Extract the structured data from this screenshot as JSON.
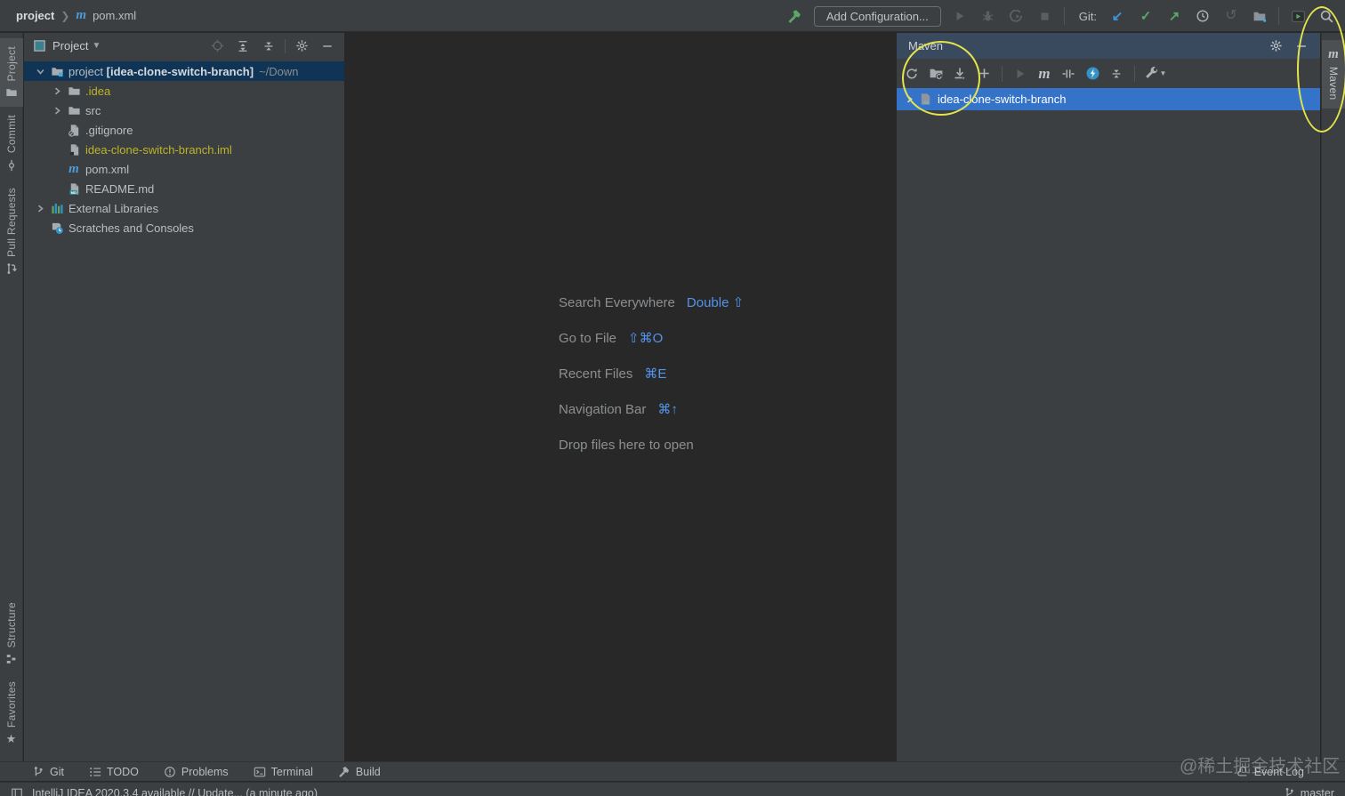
{
  "topbar": {
    "breadcrumb_project": "project",
    "breadcrumb_file": "pom.xml",
    "add_configuration": "Add Configuration...",
    "git_label": "Git:",
    "update_glyph": "↙",
    "commit_glyph": "✓",
    "push_glyph": "↗",
    "rollback_glyph": "↺"
  },
  "left_strip": {
    "project": "Project",
    "commit": "Commit",
    "pull_requests": "Pull Requests",
    "structure": "Structure",
    "favorites": "Favorites"
  },
  "project_panel": {
    "title": "Project",
    "tree": [
      {
        "name": "project",
        "bold": "[idea-clone-switch-branch]",
        "suffix": "~/Down"
      },
      {
        "label": ".idea"
      },
      {
        "label": "src"
      },
      {
        "label": ".gitignore"
      },
      {
        "label": "idea-clone-switch-branch.iml"
      },
      {
        "label": "pom.xml"
      },
      {
        "label": "README.md"
      },
      {
        "label": "External Libraries"
      },
      {
        "label": "Scratches and Consoles"
      }
    ]
  },
  "editor": {
    "shortcuts": [
      {
        "label": "Search Everywhere",
        "keys": "Double ⇧"
      },
      {
        "label": "Go to File",
        "keys": "⇧⌘O"
      },
      {
        "label": "Recent Files",
        "keys": "⌘E"
      },
      {
        "label": "Navigation Bar",
        "keys": "⌘↑"
      },
      {
        "label": "Drop files here to open",
        "keys": ""
      }
    ]
  },
  "maven_panel": {
    "title": "Maven",
    "project": "idea-clone-switch-branch",
    "goal_glyph": "m"
  },
  "right_strip": {
    "maven": "Maven",
    "m_glyph": "m"
  },
  "bottom_bar": {
    "git": "Git",
    "todo": "TODO",
    "problems": "Problems",
    "terminal": "Terminal",
    "build": "Build",
    "event_log": "Event Log"
  },
  "status_bar": {
    "message": "IntelliJ IDEA 2020.3.4 available // Update... (a minute ago)",
    "branch": "master"
  },
  "watermark": "@稀土掘金技术社区",
  "colors": {
    "panel_bg": "#3C3F41",
    "editor_bg": "#282828",
    "maven_header_bg": "#3A4A5E",
    "selection_focused": "#3573C9",
    "selection_unfocused": "#0F3456",
    "shortcut_blue": "#5394EC",
    "excluded_yellow": "#BBB529",
    "green": "#59A869",
    "git_blue": "#3B96D9",
    "annotation_yellow": "#E3E34B"
  }
}
